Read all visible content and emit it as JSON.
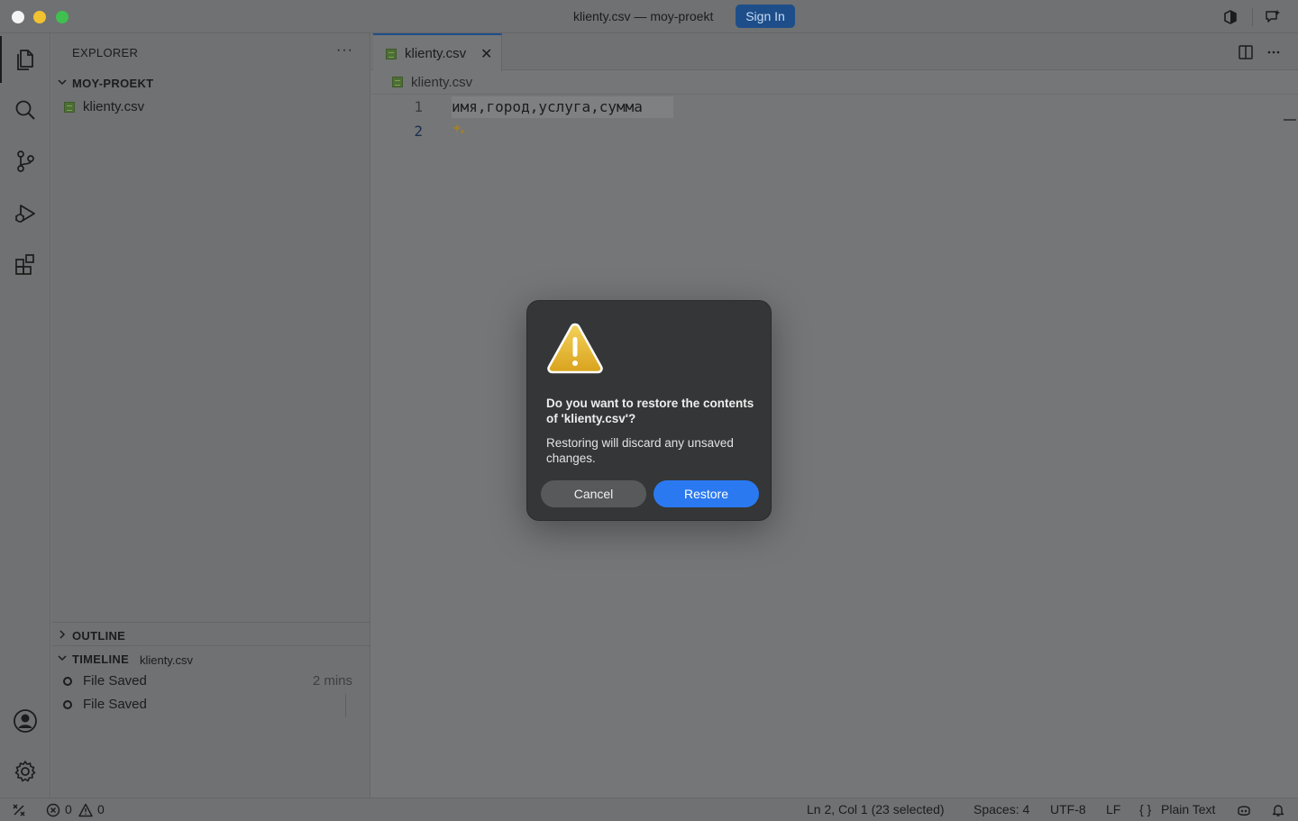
{
  "window": {
    "title": "klienty.csv — moy-proekt",
    "sign_in_label": "Sign In"
  },
  "activity_bar": {
    "items": [
      "explorer-icon",
      "search-icon",
      "source-control-icon",
      "run-debug-icon",
      "extensions-icon"
    ],
    "bottom": [
      "account-icon",
      "settings-gear-icon"
    ]
  },
  "sidebar": {
    "title": "EXPLORER",
    "more": "···",
    "project": {
      "name": "MOY-PROEKT",
      "files": [
        {
          "name": "klienty.csv"
        }
      ]
    },
    "outline": {
      "label": "OUTLINE"
    },
    "timeline": {
      "label": "TIMELINE",
      "file": "klienty.csv",
      "items": [
        {
          "label": "File Saved",
          "time": "2 mins"
        },
        {
          "label": "File Saved",
          "time": ""
        }
      ]
    }
  },
  "editor": {
    "tab": {
      "label": "klienty.csv",
      "close": "✕"
    },
    "breadcrumb": "klienty.csv",
    "lines": [
      {
        "number": "1",
        "text": "имя,город,услуга,сумма"
      },
      {
        "number": "2",
        "text": ""
      }
    ]
  },
  "dialog": {
    "title": "Do you want to restore the contents of 'klienty.csv'?",
    "message": "Restoring will discard any unsaved changes.",
    "cancel_label": "Cancel",
    "restore_label": "Restore",
    "accent_color": "#2a79f0"
  },
  "status_bar": {
    "errors": "0",
    "warnings": "0",
    "cursor": "Ln 2, Col 1 (23 selected)",
    "spaces": "Spaces: 4",
    "encoding": "UTF-8",
    "eol": "LF",
    "language_braces": "{ }",
    "language": "Plain Text"
  }
}
